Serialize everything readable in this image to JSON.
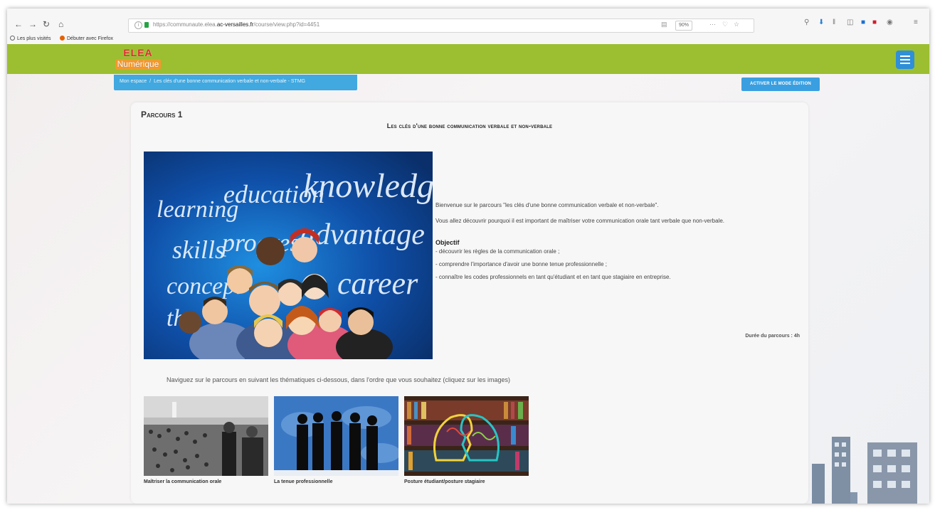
{
  "browser": {
    "url_prefix": "https://communaute.elea.",
    "url_domain": "ac-versailles.fr",
    "url_path": "/course/view.php?id=4451",
    "zoom": "90%",
    "bookmarks": [
      "Les plus visités",
      "Débuter avec Firefox"
    ]
  },
  "site": {
    "logo_top": "ELEA",
    "logo_bottom": "Numérique",
    "breadcrumb": [
      "Mon espace",
      "Les clés d'une bonne communication verbale et non-verbale - STMG"
    ],
    "edit_button": "ACTIVER LE MODE ÉDITION"
  },
  "course": {
    "section_title": "Parcours 1",
    "title": "Les clés d'une bonne communication verbale et non-verbale",
    "hero_words": [
      "learning",
      "education",
      "knowledge",
      "skills",
      "progress",
      "advantage",
      "concept",
      "career",
      "the"
    ],
    "intro": [
      "Bienvenue sur le parcours \"les clés d'une bonne communication verbale et non-verbale\".",
      "Vous allez découvrir pourquoi il est important de maîtriser votre communication orale tant verbale que non-verbale."
    ],
    "objective_title": "Objectif",
    "objectives": [
      "- découvrir les règles de la communication orale ;",
      "- comprendre l'importance d'avoir une bonne tenue professionnelle ;",
      "- connaître les codes professionnels en tant qu'étudiant et en tant que stagiaire en entreprise."
    ],
    "duration": "Durée du parcours : 4h",
    "nav_instruction": "Naviguez sur le parcours en suivant les thématiques ci-dessous, dans l'ordre que vous souhaitez (cliquez sur les images)",
    "topics": [
      {
        "label": "Maîtriser la communication orale"
      },
      {
        "label": "La tenue professionnelle"
      },
      {
        "label": "Posture étudiant/posture stagiaire"
      }
    ]
  },
  "colors": {
    "header": "#9cbe31",
    "accent_blue": "#41a8e0",
    "menu_blue": "#2f8fd8"
  }
}
